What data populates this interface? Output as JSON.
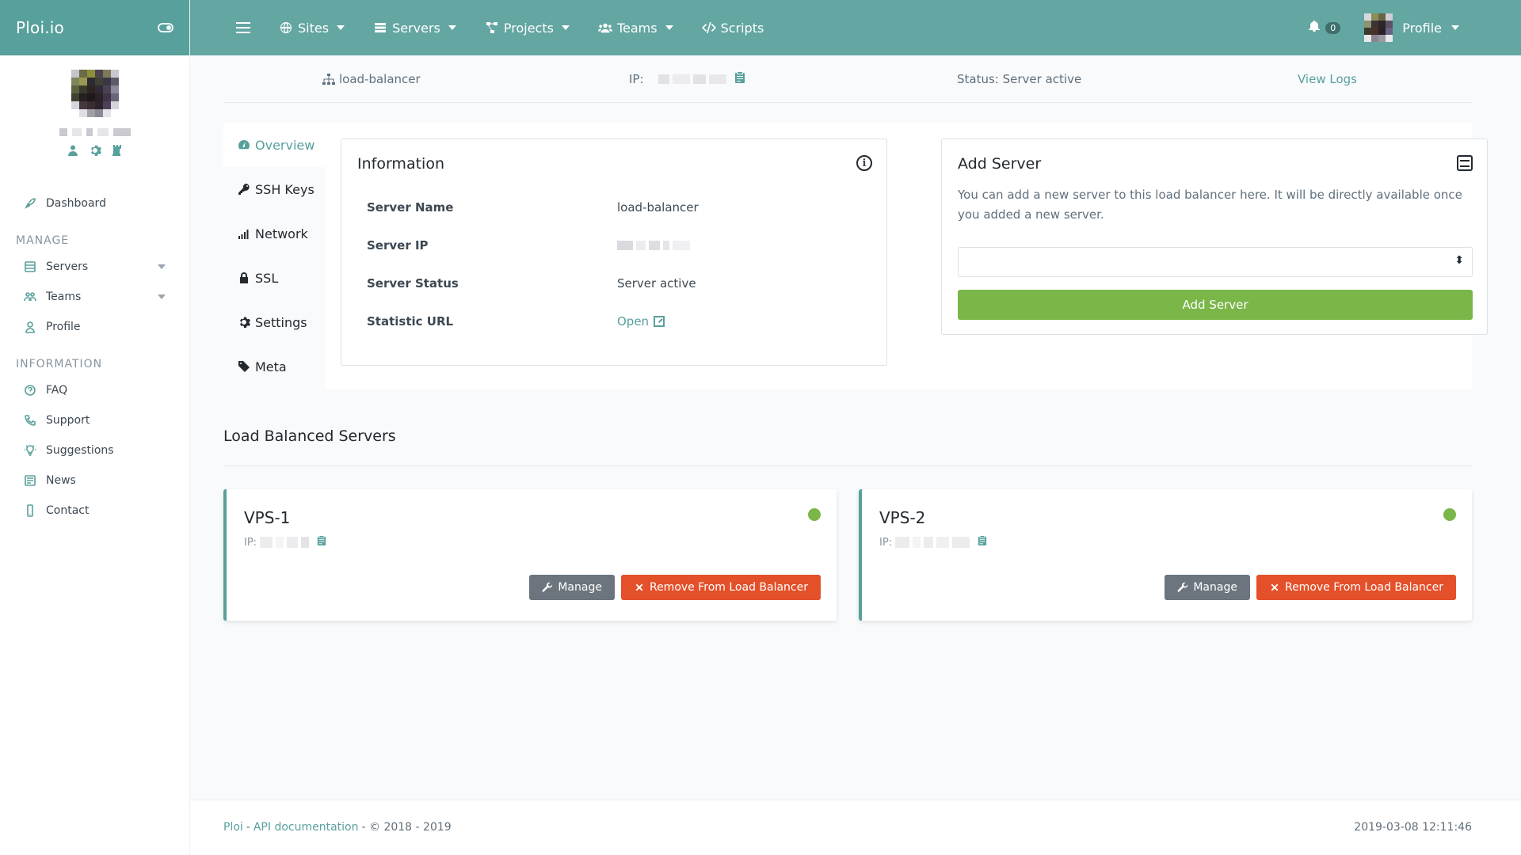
{
  "brand": {
    "name": "Ploi.io"
  },
  "sidebar": {
    "items_top": [
      {
        "label": "Dashboard",
        "icon": "rocket-icon"
      }
    ],
    "sections": [
      {
        "title": "MANAGE",
        "items": [
          {
            "label": "Servers",
            "icon": "server-icon",
            "has_dropdown": true
          },
          {
            "label": "Teams",
            "icon": "users-icon",
            "has_dropdown": true
          },
          {
            "label": "Profile",
            "icon": "user-icon",
            "has_dropdown": false
          }
        ]
      },
      {
        "title": "INFORMATION",
        "items": [
          {
            "label": "FAQ",
            "icon": "question-icon"
          },
          {
            "label": "Support",
            "icon": "phone-icon"
          },
          {
            "label": "Suggestions",
            "icon": "lightbulb-icon"
          },
          {
            "label": "News",
            "icon": "newspaper-icon"
          },
          {
            "label": "Contact",
            "icon": "mobile-icon"
          }
        ]
      }
    ]
  },
  "topbar": {
    "nav": [
      {
        "label": "Sites",
        "icon": "globe-icon",
        "dropdown": true
      },
      {
        "label": "Servers",
        "icon": "server-icon",
        "dropdown": true
      },
      {
        "label": "Projects",
        "icon": "project-diagram-icon",
        "dropdown": true
      },
      {
        "label": "Teams",
        "icon": "users-icon",
        "dropdown": true
      },
      {
        "label": "Scripts",
        "icon": "code-icon",
        "dropdown": false
      }
    ],
    "notifications_count": "0",
    "profile_label": "Profile"
  },
  "infobar": {
    "hostname": "load-balancer",
    "ip_label": "IP:",
    "status": "Status: Server active",
    "view_logs": "View Logs"
  },
  "tabs": [
    {
      "label": "Overview",
      "icon": "tachometer-icon",
      "active": true
    },
    {
      "label": "SSH Keys",
      "icon": "key-icon",
      "active": false
    },
    {
      "label": "Network",
      "icon": "signal-icon",
      "active": false
    },
    {
      "label": "SSL",
      "icon": "lock-icon",
      "active": false
    },
    {
      "label": "Settings",
      "icon": "cog-icon",
      "active": false
    },
    {
      "label": "Meta",
      "icon": "tag-icon",
      "active": false
    }
  ],
  "information": {
    "title": "Information",
    "rows": [
      {
        "key": "Server Name",
        "value": "load-balancer"
      },
      {
        "key": "Server IP",
        "value": ""
      },
      {
        "key": "Server Status",
        "value": "Server active"
      },
      {
        "key": "Statistic URL",
        "value": "Open"
      }
    ]
  },
  "add_server": {
    "title": "Add Server",
    "description": "You can add a new server to this load balancer here. It will be directly available once you added a new server.",
    "select_value": "",
    "button": "Add Server"
  },
  "load_balanced": {
    "title": "Load Balanced Servers",
    "servers": [
      {
        "name": "VPS-1",
        "ip_label": "IP:",
        "status_color": "#7ab648",
        "manage": "Manage",
        "remove": "Remove From Load Balancer"
      },
      {
        "name": "VPS-2",
        "ip_label": "IP:",
        "status_color": "#7ab648",
        "manage": "Manage",
        "remove": "Remove From Load Balancer"
      }
    ]
  },
  "footer": {
    "brand_link": "Ploi",
    "sep1": "-",
    "api_link": "API documentation",
    "copyright": "- © 2018 - 2019",
    "timestamp": "2019-03-08 12:11:46"
  },
  "colors": {
    "accent": "#58a09c",
    "topbar": "#63a6a2",
    "success": "#7ab648",
    "danger": "#e4502a"
  }
}
